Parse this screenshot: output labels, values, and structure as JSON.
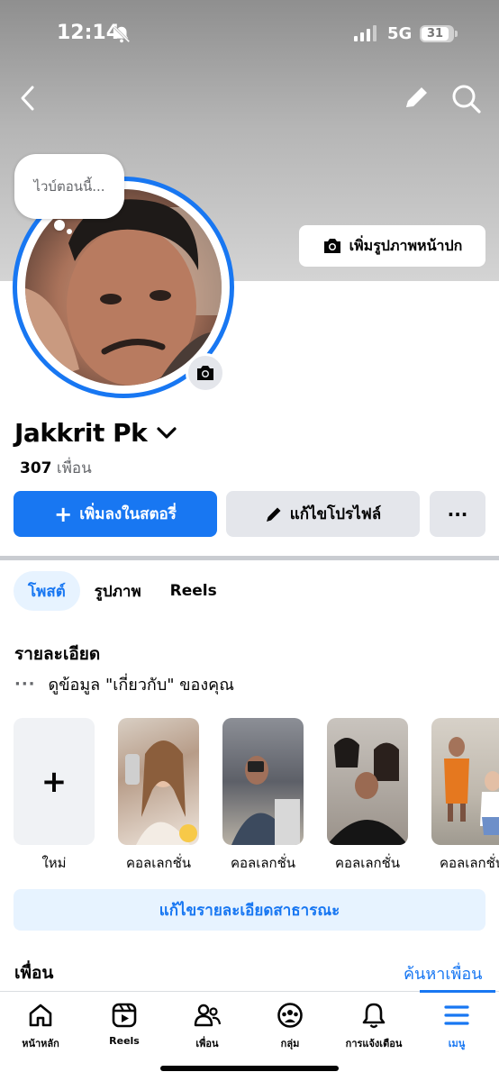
{
  "status_bar": {
    "time": "12:14",
    "network": "5G",
    "battery": "31"
  },
  "profile": {
    "thought": "ไวบ์ตอนนี้...",
    "add_cover_label": "เพิ่มรูปภาพหน้าปก",
    "name": "Jakkrit Pk",
    "friends_number": "307",
    "friends_word": "เพื่อน"
  },
  "actions": {
    "add_story": "เพิ่มลงในสตอรี่",
    "edit_profile": "แก้ไขโปรไฟล์",
    "more": "···"
  },
  "tabs": [
    {
      "label": "โพสต์",
      "active": true
    },
    {
      "label": "รูปภาพ",
      "active": false
    },
    {
      "label": "Reels",
      "active": false
    }
  ],
  "details": {
    "title": "รายละเอียด",
    "about_text": "ดูข้อมูล \"เกี่ยวกับ\" ของคุณ",
    "edit_button": "แก้ไขรายละเอียดสาธารณะ"
  },
  "highlights": {
    "new_label": "ใหม่",
    "items": [
      {
        "label": "คอลเลกชั่น"
      },
      {
        "label": "คอลเลกชั่น"
      },
      {
        "label": "คอลเลกชั่น"
      },
      {
        "label": "คอลเลกชั่น"
      }
    ]
  },
  "friends": {
    "title": "เพื่อน",
    "find_link": "ค้นหาเพื่อน"
  },
  "bottom_nav": [
    {
      "label": "หน้าหลัก",
      "icon": "home-icon",
      "active": false
    },
    {
      "label": "Reels",
      "icon": "reels-icon",
      "active": false
    },
    {
      "label": "เพื่อน",
      "icon": "friends-icon",
      "active": false
    },
    {
      "label": "กลุ่ม",
      "icon": "groups-icon",
      "active": false
    },
    {
      "label": "การแจ้งเตือน",
      "icon": "bell-icon",
      "active": false
    },
    {
      "label": "เมนู",
      "icon": "menu-icon",
      "active": true
    }
  ],
  "colors": {
    "accent": "#1877f2",
    "secondary_button": "#e4e6eb",
    "tab_active_bg": "#e7f3ff"
  }
}
